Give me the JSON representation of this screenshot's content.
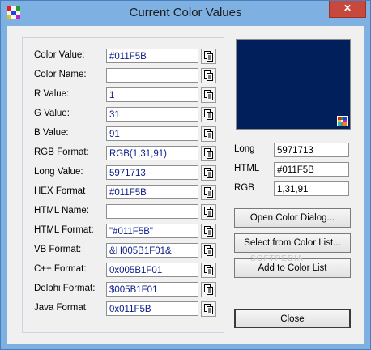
{
  "window": {
    "title": "Current Color Values",
    "close_label": "✕"
  },
  "preview_color": "#011F5B",
  "fields": [
    {
      "label": "Color Value:",
      "value": "#011F5B"
    },
    {
      "label": "Color Name:",
      "value": ""
    },
    {
      "label": "R Value:",
      "value": "1"
    },
    {
      "label": "G Value:",
      "value": "31"
    },
    {
      "label": "B Value:",
      "value": "91"
    },
    {
      "label": "RGB Format:",
      "value": "RGB(1,31,91)"
    },
    {
      "label": "Long Value:",
      "value": "5971713"
    },
    {
      "label": "HEX Format",
      "value": "#011F5B"
    },
    {
      "label": "HTML Name:",
      "value": ""
    },
    {
      "label": "HTML Format:",
      "value": "\"#011F5B\""
    },
    {
      "label": "VB Format:",
      "value": "&H005B1F01&"
    },
    {
      "label": "C++ Format:",
      "value": "0x005B1F01"
    },
    {
      "label": "Delphi Format:",
      "value": "$005B1F01"
    },
    {
      "label": "Java Format:",
      "value": "0x011F5B"
    }
  ],
  "summary": {
    "long_label": "Long",
    "long_value": "5971713",
    "html_label": "HTML",
    "html_value": "#011F5B",
    "rgb_label": "RGB",
    "rgb_value": "1,31,91"
  },
  "buttons": {
    "open_dialog": "Open Color Dialog...",
    "select_list": "Select from Color List...",
    "add_list": "Add to Color List",
    "close": "Close"
  },
  "watermark": "SOFTPEDIA"
}
